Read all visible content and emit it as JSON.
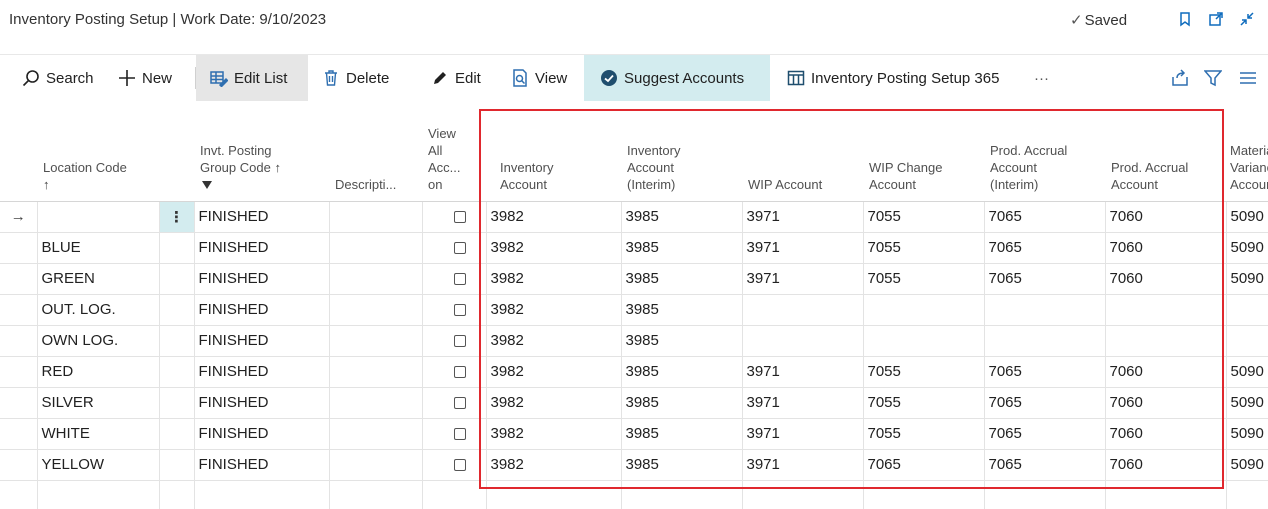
{
  "page": {
    "title": "Inventory Posting Setup | Work Date: 9/10/2023",
    "saved_label": "Saved"
  },
  "toolbar": {
    "search_label": "Search",
    "new_label": "New",
    "edit_list_label": "Edit List",
    "delete_label": "Delete",
    "edit_label": "Edit",
    "view_label": "View",
    "suggest_label": "Suggest Accounts",
    "report_label": "Inventory Posting Setup 365",
    "more_label": "···"
  },
  "columns": {
    "location_code": "Location Code",
    "invt_posting_group_code_1": "Invt. Posting",
    "invt_posting_group_code_2": "Group Code",
    "description": "Descripti...",
    "view_all_1": "View",
    "view_all_2": "All",
    "view_all_3": "Acc...",
    "view_all_4": "on",
    "inventory_account_1": "Inventory",
    "inventory_account_2": "Account",
    "inventory_interim_1": "Inventory",
    "inventory_interim_2": "Account",
    "inventory_interim_3": "(Interim)",
    "wip_account": "WIP Account",
    "wip_change_1": "WIP Change",
    "wip_change_2": "Account",
    "prod_accrual_interim_1": "Prod. Accrual",
    "prod_accrual_interim_2": "Account",
    "prod_accrual_interim_3": "(Interim)",
    "prod_accrual_1": "Prod. Accrual",
    "prod_accrual_2": "Account",
    "material_variance_1": "Material",
    "material_variance_2": "Variance",
    "material_variance_3": "Account"
  },
  "rows": [
    {
      "location": "",
      "group": "FINISHED",
      "inv": "3982",
      "inv_interim": "3985",
      "wip": "3971",
      "wip_change": "7055",
      "prod_interim": "7065",
      "prod": "7060",
      "mat_var": "5090"
    },
    {
      "location": "BLUE",
      "group": "FINISHED",
      "inv": "3982",
      "inv_interim": "3985",
      "wip": "3971",
      "wip_change": "7055",
      "prod_interim": "7065",
      "prod": "7060",
      "mat_var": "5090"
    },
    {
      "location": "GREEN",
      "group": "FINISHED",
      "inv": "3982",
      "inv_interim": "3985",
      "wip": "3971",
      "wip_change": "7055",
      "prod_interim": "7065",
      "prod": "7060",
      "mat_var": "5090"
    },
    {
      "location": "OUT. LOG.",
      "group": "FINISHED",
      "inv": "3982",
      "inv_interim": "3985",
      "wip": "",
      "wip_change": "",
      "prod_interim": "",
      "prod": "",
      "mat_var": ""
    },
    {
      "location": "OWN LOG.",
      "group": "FINISHED",
      "inv": "3982",
      "inv_interim": "3985",
      "wip": "",
      "wip_change": "",
      "prod_interim": "",
      "prod": "",
      "mat_var": ""
    },
    {
      "location": "RED",
      "group": "FINISHED",
      "inv": "3982",
      "inv_interim": "3985",
      "wip": "3971",
      "wip_change": "7055",
      "prod_interim": "7065",
      "prod": "7060",
      "mat_var": "5090"
    },
    {
      "location": "SILVER",
      "group": "FINISHED",
      "inv": "3982",
      "inv_interim": "3985",
      "wip": "3971",
      "wip_change": "7055",
      "prod_interim": "7065",
      "prod": "7060",
      "mat_var": "5090"
    },
    {
      "location": "WHITE",
      "group": "FINISHED",
      "inv": "3982",
      "inv_interim": "3985",
      "wip": "3971",
      "wip_change": "7055",
      "prod_interim": "7065",
      "prod": "7060",
      "mat_var": "5090"
    },
    {
      "location": "YELLOW",
      "group": "FINISHED",
      "inv": "3982",
      "inv_interim": "3985",
      "wip": "3971",
      "wip_change": "7065",
      "prod_interim": "7065",
      "prod": "7060",
      "mat_var": "5090"
    }
  ],
  "colors": {
    "highlight": "#e0282e",
    "accent": "#0f6cbd",
    "suggest_bg": "#d3ecef",
    "edit_list_bg": "#e6e6e6"
  },
  "icons": {
    "search": "search-icon",
    "new": "plus-icon",
    "edit_list": "edit-list-icon",
    "delete": "trash-icon",
    "edit": "pencil-icon",
    "view": "view-icon",
    "suggest": "check-circle-icon",
    "report": "table-icon",
    "share": "share-icon",
    "filter": "filter-icon",
    "list": "list-icon",
    "bookmark": "bookmark-icon",
    "open_new": "open-new-window-icon",
    "collapse": "collapse-icon"
  }
}
